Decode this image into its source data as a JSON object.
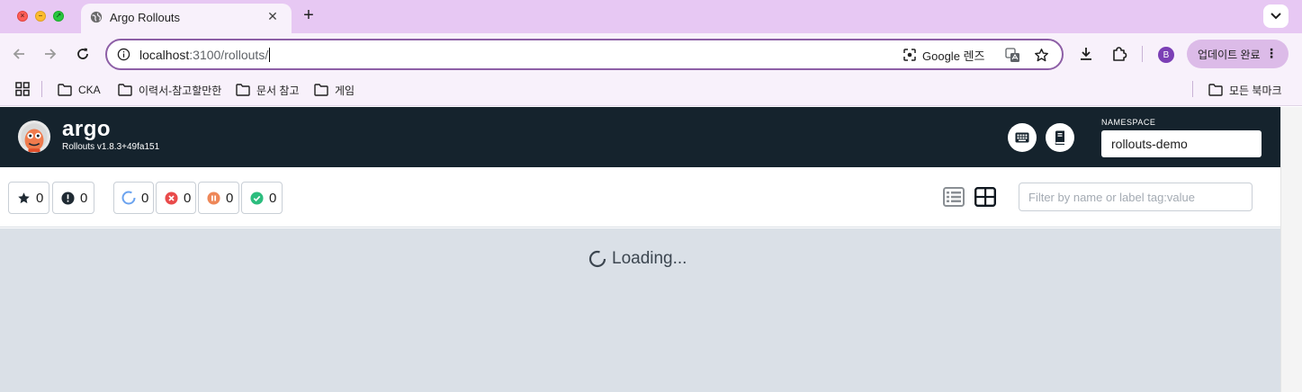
{
  "browser": {
    "tab": {
      "title": "Argo Rollouts",
      "close": "✕"
    },
    "new_tab": "+",
    "url": {
      "host": "localhost",
      "rest": ":3100/rollouts/"
    },
    "lens_label": "Google 렌즈",
    "profile_initial": "B",
    "update_label": "업데이트 완료",
    "bookmarks": [
      {
        "label": "CKA"
      },
      {
        "label": "이력서-참고할만한"
      },
      {
        "label": "문서 참고"
      },
      {
        "label": "게임"
      }
    ],
    "all_bookmarks": "모든 북마크"
  },
  "argo": {
    "brand": "argo",
    "version": "Rollouts v1.8.3+49fa151",
    "namespace_label": "NAMESPACE",
    "namespace_value": "rollouts-demo"
  },
  "filters": {
    "favorites_count": "0",
    "warnings_count": "0",
    "progressing_count": "0",
    "degraded_count": "0",
    "paused_count": "0",
    "healthy_count": "0",
    "search_placeholder": "Filter by name or label tag:value"
  },
  "content": {
    "loading_text": "Loading..."
  },
  "colors": {
    "tabstrip": "#e7c8f3",
    "argo_header": "#15232d",
    "content_bg": "#dae0e7",
    "progressing": "#6ba3ef",
    "degraded": "#e94b4b",
    "paused": "#ee8758",
    "healthy": "#2cbd7e"
  }
}
